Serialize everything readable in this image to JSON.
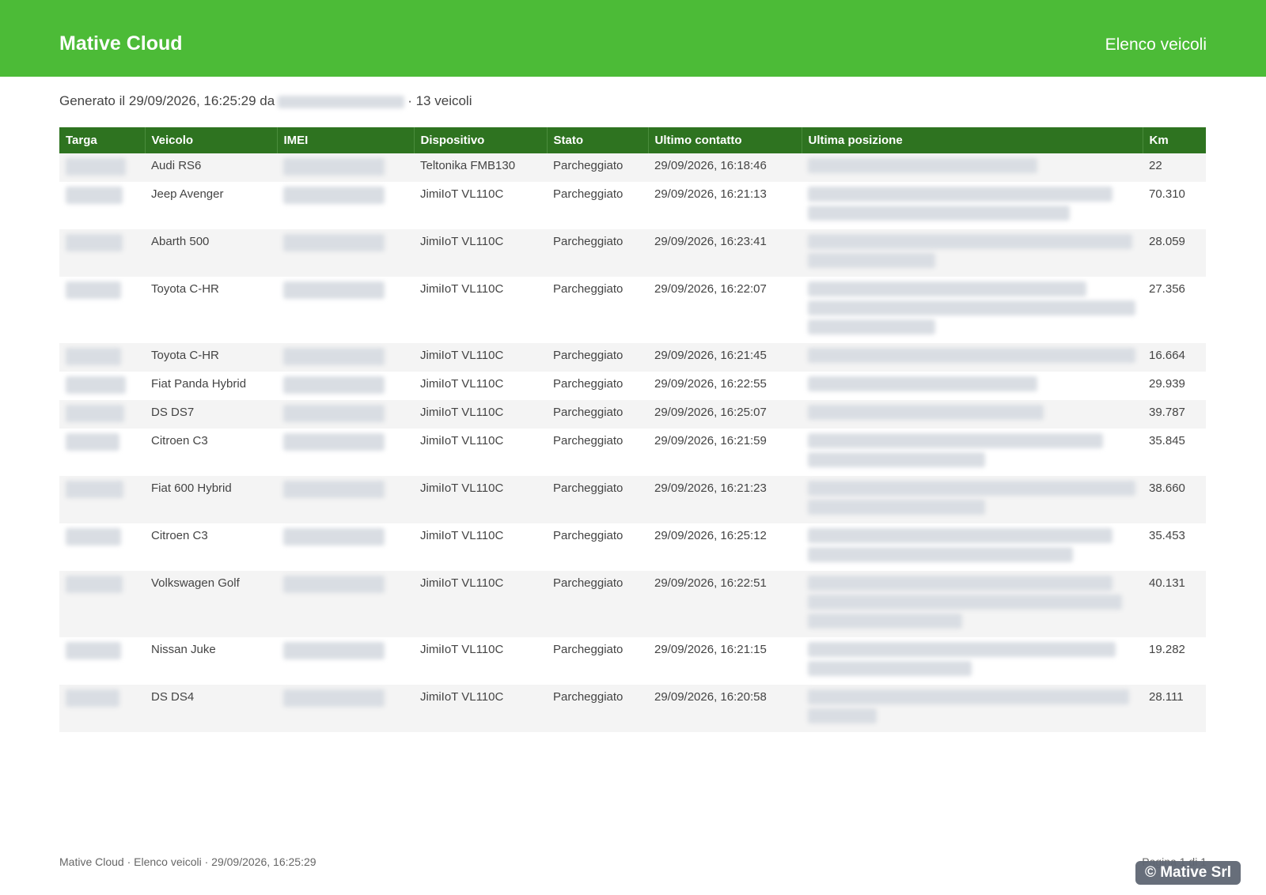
{
  "header": {
    "brand": "Mative Cloud",
    "title": "Elenco veicoli"
  },
  "meta": {
    "prefix": "Generato il 29/09/2026, 16:25:29 da",
    "suffix": "· 13 veicoli"
  },
  "table": {
    "columns": [
      "Targa",
      "Veicolo",
      "IMEI",
      "Dispositivo",
      "Stato",
      "Ultimo contatto",
      "Ultima posizione",
      "Km"
    ],
    "rows": [
      {
        "vehicle": "Audi RS6",
        "device": "Teltonika FMB130",
        "status": "Parcheggiato",
        "last_contact": "29/09/2026, 16:18:46",
        "km": "22",
        "pos_lines": [
          0.7
        ]
      },
      {
        "vehicle": "Jeep Avenger",
        "device": "JimiIoT VL110C",
        "status": "Parcheggiato",
        "last_contact": "29/09/2026, 16:21:13",
        "km": "70.310",
        "pos_lines": [
          0.93,
          0.8
        ]
      },
      {
        "vehicle": "Abarth 500",
        "device": "JimiIoT VL110C",
        "status": "Parcheggiato",
        "last_contact": "29/09/2026, 16:23:41",
        "km": "28.059",
        "pos_lines": [
          0.99,
          0.39
        ]
      },
      {
        "vehicle": "Toyota C-HR",
        "device": "JimiIoT VL110C",
        "status": "Parcheggiato",
        "last_contact": "29/09/2026, 16:22:07",
        "km": "27.356",
        "pos_lines": [
          0.85,
          1.0,
          0.39
        ]
      },
      {
        "vehicle": "Toyota C-HR",
        "device": "JimiIoT VL110C",
        "status": "Parcheggiato",
        "last_contact": "29/09/2026, 16:21:45",
        "km": "16.664",
        "pos_lines": [
          1.0
        ]
      },
      {
        "vehicle": "Fiat Panda Hybrid",
        "device": "JimiIoT VL110C",
        "status": "Parcheggiato",
        "last_contact": "29/09/2026, 16:22:55",
        "km": "29.939",
        "pos_lines": [
          0.7
        ]
      },
      {
        "vehicle": "DS DS7",
        "device": "JimiIoT VL110C",
        "status": "Parcheggiato",
        "last_contact": "29/09/2026, 16:25:07",
        "km": "39.787",
        "pos_lines": [
          0.72
        ]
      },
      {
        "vehicle": "Citroen C3",
        "device": "JimiIoT VL110C",
        "status": "Parcheggiato",
        "last_contact": "29/09/2026, 16:21:59",
        "km": "35.845",
        "pos_lines": [
          0.9,
          0.54
        ]
      },
      {
        "vehicle": "Fiat 600 Hybrid",
        "device": "JimiIoT VL110C",
        "status": "Parcheggiato",
        "last_contact": "29/09/2026, 16:21:23",
        "km": "38.660",
        "pos_lines": [
          1.0,
          0.54
        ]
      },
      {
        "vehicle": "Citroen C3",
        "device": "JimiIoT VL110C",
        "status": "Parcheggiato",
        "last_contact": "29/09/2026, 16:25:12",
        "km": "35.453",
        "pos_lines": [
          0.93,
          0.81
        ]
      },
      {
        "vehicle": "Volkswagen Golf",
        "device": "JimiIoT VL110C",
        "status": "Parcheggiato",
        "last_contact": "29/09/2026, 16:22:51",
        "km": "40.131",
        "pos_lines": [
          0.93,
          0.96,
          0.47
        ]
      },
      {
        "vehicle": "Nissan Juke",
        "device": "JimiIoT VL110C",
        "status": "Parcheggiato",
        "last_contact": "29/09/2026, 16:21:15",
        "km": "19.282",
        "pos_lines": [
          0.94,
          0.5
        ]
      },
      {
        "vehicle": "DS DS4",
        "device": "JimiIoT VL110C",
        "status": "Parcheggiato",
        "last_contact": "29/09/2026, 16:20:58",
        "km": "28.111",
        "pos_lines": [
          0.98,
          0.21
        ]
      }
    ]
  },
  "footer": {
    "left": "Mative Cloud · Elenco veicoli · 29/09/2026, 16:25:29",
    "right": "Pagina 1 di 1"
  },
  "watermark": "© Mative Srl"
}
